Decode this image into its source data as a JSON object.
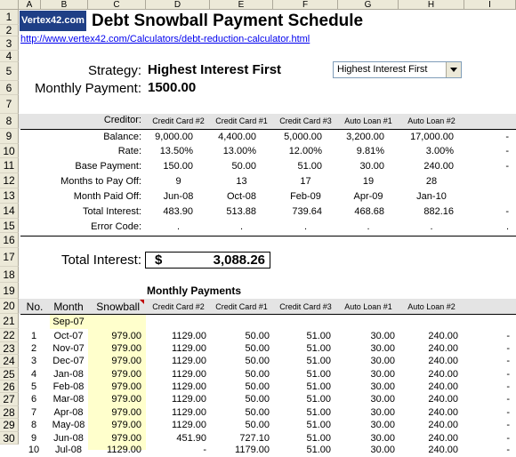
{
  "columns": [
    "A",
    "B",
    "C",
    "D",
    "E",
    "F",
    "G",
    "H",
    "I"
  ],
  "rows": [
    "1",
    "2",
    "3",
    "4",
    "5",
    "6",
    "7",
    "8",
    "9",
    "10",
    "11",
    "12",
    "13",
    "14",
    "15",
    "16",
    "17",
    "18",
    "19",
    "20",
    "21",
    "22",
    "23",
    "24",
    "25",
    "26",
    "27",
    "28",
    "29",
    "30"
  ],
  "logo": "Vertex42.com",
  "title": "Debt Snowball Payment Schedule",
  "link": "http://www.vertex42.com/Calculators/debt-reduction-calculator.html",
  "strategy_label": "Strategy:",
  "strategy_value": "Highest Interest First",
  "strategy_dropdown": "Highest Interest First",
  "monthly_payment_label": "Monthly Payment:",
  "monthly_payment_value": "1500.00",
  "creditor_label": "Creditor:",
  "creditors": [
    "Credit Card #2",
    "Credit Card #1",
    "Credit Card #3",
    "Auto Loan #1",
    "Auto Loan #2"
  ],
  "summary_rows": [
    {
      "label": "Balance:",
      "values": [
        "9,000.00",
        "4,400.00",
        "5,000.00",
        "3,200.00",
        "17,000.00"
      ],
      "extra": "-"
    },
    {
      "label": "Rate:",
      "values": [
        "13.50%",
        "13.00%",
        "12.00%",
        "9.81%",
        "3.00%"
      ],
      "extra": "-"
    },
    {
      "label": "Base Payment:",
      "values": [
        "150.00",
        "50.00",
        "51.00",
        "30.00",
        "240.00"
      ],
      "extra": "-"
    },
    {
      "label": "Months to Pay Off:",
      "values": [
        "9",
        "13",
        "17",
        "19",
        "28"
      ],
      "extra": ""
    },
    {
      "label": "Month Paid Off:",
      "values": [
        "Jun-08",
        "Oct-08",
        "Feb-09",
        "Apr-09",
        "Jan-10"
      ],
      "extra": ""
    },
    {
      "label": "Total Interest:",
      "values": [
        "483.90",
        "513.88",
        "739.64",
        "468.68",
        "882.16"
      ],
      "extra": "-"
    },
    {
      "label": "Error Code:",
      "values": [
        ".",
        ".",
        ".",
        ".",
        "."
      ],
      "extra": "."
    }
  ],
  "total_interest_label": "Total Interest:",
  "total_interest_currency": "$",
  "total_interest_value": "3,088.26",
  "monthly_payments_heading": "Monthly Payments",
  "schedule_headers": {
    "no": "No.",
    "month": "Month",
    "snowball": "Snowball"
  },
  "start_month": "Sep-07",
  "schedule": [
    {
      "no": "1",
      "month": "Oct-07",
      "snowball": "979.00",
      "values": [
        "1129.00",
        "50.00",
        "51.00",
        "30.00",
        "240.00"
      ],
      "extra": "-"
    },
    {
      "no": "2",
      "month": "Nov-07",
      "snowball": "979.00",
      "values": [
        "1129.00",
        "50.00",
        "51.00",
        "30.00",
        "240.00"
      ],
      "extra": "-"
    },
    {
      "no": "3",
      "month": "Dec-07",
      "snowball": "979.00",
      "values": [
        "1129.00",
        "50.00",
        "51.00",
        "30.00",
        "240.00"
      ],
      "extra": "-"
    },
    {
      "no": "4",
      "month": "Jan-08",
      "snowball": "979.00",
      "values": [
        "1129.00",
        "50.00",
        "51.00",
        "30.00",
        "240.00"
      ],
      "extra": "-"
    },
    {
      "no": "5",
      "month": "Feb-08",
      "snowball": "979.00",
      "values": [
        "1129.00",
        "50.00",
        "51.00",
        "30.00",
        "240.00"
      ],
      "extra": "-"
    },
    {
      "no": "6",
      "month": "Mar-08",
      "snowball": "979.00",
      "values": [
        "1129.00",
        "50.00",
        "51.00",
        "30.00",
        "240.00"
      ],
      "extra": "-"
    },
    {
      "no": "7",
      "month": "Apr-08",
      "snowball": "979.00",
      "values": [
        "1129.00",
        "50.00",
        "51.00",
        "30.00",
        "240.00"
      ],
      "extra": "-"
    },
    {
      "no": "8",
      "month": "May-08",
      "snowball": "979.00",
      "values": [
        "1129.00",
        "50.00",
        "51.00",
        "30.00",
        "240.00"
      ],
      "extra": "-"
    },
    {
      "no": "9",
      "month": "Jun-08",
      "snowball": "979.00",
      "values": [
        "451.90",
        "727.10",
        "51.00",
        "30.00",
        "240.00"
      ],
      "extra": "-"
    },
    {
      "no": "10",
      "month": "Jul-08",
      "snowball": "1129.00",
      "values": [
        "-",
        "1179.00",
        "51.00",
        "30.00",
        "240.00"
      ],
      "extra": "-"
    }
  ]
}
